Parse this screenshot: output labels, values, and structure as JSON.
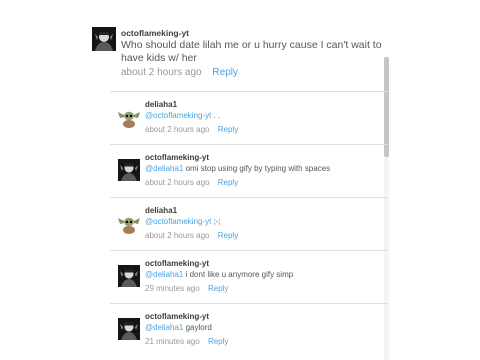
{
  "top_comment": {
    "username": "octoflameking-yt",
    "text_line1": "Who should date lilah me or u hurry cause I can't wait to",
    "text_line2": "have kids w/ her",
    "time": "about 2 hours ago",
    "reply_label": "Reply"
  },
  "replies": [
    {
      "username": "deliaha1",
      "mention": "@octoflameking-yt",
      "text": " . .",
      "time": "about 2 hours ago",
      "reply_label": "Reply",
      "avatar": "baby-yoda"
    },
    {
      "username": "octoflameking-yt",
      "mention": "@deliaha1",
      "text": " omi stop using gify by typing with spaces",
      "time": "about 2 hours ago",
      "reply_label": "Reply",
      "avatar": "dark-portrait"
    },
    {
      "username": "deliaha1",
      "mention": "@octoflameking-yt",
      "text": " ;-;",
      "time": "about 2 hours ago",
      "reply_label": "Reply",
      "avatar": "baby-yoda"
    },
    {
      "username": "octoflameking-yt",
      "mention": "@deliaha1",
      "text": " i dont like u anymore gify simp",
      "time": "29 minutes ago",
      "reply_label": "Reply",
      "avatar": "dark-portrait"
    },
    {
      "username": "octoflameking-yt",
      "mention": "@deliaha1",
      "text": " gaylord",
      "time": "21 minutes ago",
      "reply_label": "Reply",
      "avatar": "dark-portrait"
    }
  ],
  "colors": {
    "link": "#4ca3dd",
    "meta": "#999999",
    "text": "#575757",
    "divider": "#dedede"
  }
}
